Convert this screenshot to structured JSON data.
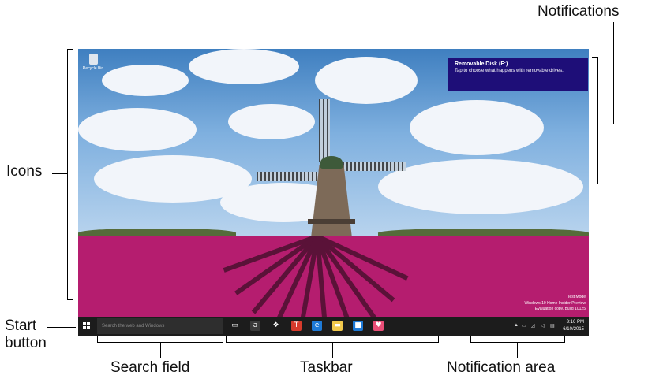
{
  "labels": {
    "notifications": "Notifications",
    "icons": "Icons",
    "start_button_line1": "Start",
    "start_button_line2": "button",
    "search_field": "Search field",
    "taskbar": "Taskbar",
    "notification_area": "Notification area"
  },
  "desktop": {
    "recycle_bin_label": "Recycle Bin",
    "notification": {
      "title": "Removable Disk (F:)",
      "body": "Tap to choose what happens with removable drives."
    },
    "watermark": {
      "line1": "Test Mode",
      "line2": "Windows 10 Home Insider Preview",
      "line3": "Evaluation copy. Build 10125"
    }
  },
  "taskbar": {
    "search_placeholder": "Search the web and Windows",
    "pinned_apps": [
      {
        "name": "task-view",
        "glyph": "▭",
        "color": "#1c1c1c"
      },
      {
        "name": "amazon",
        "glyph": "a",
        "color": "#3a3a3a"
      },
      {
        "name": "dropbox",
        "glyph": "❖",
        "color": "#1c1c1c"
      },
      {
        "name": "app-t",
        "glyph": "T",
        "color": "#d83b2c"
      },
      {
        "name": "edge",
        "glyph": "e",
        "color": "#1e7ad6"
      },
      {
        "name": "file-explorer",
        "glyph": "▬",
        "color": "#f2c94c"
      },
      {
        "name": "store",
        "glyph": "■",
        "color": "#1e7ad6"
      },
      {
        "name": "heart-app",
        "glyph": "♥",
        "color": "#e94e77"
      }
    ],
    "clock": {
      "time": "3:16 PM",
      "date": "6/10/2015"
    }
  },
  "colors": {
    "taskbar": "#1c1c1c",
    "notification_toast": "#1e0e78",
    "tulip_field": "#b51d6f"
  }
}
